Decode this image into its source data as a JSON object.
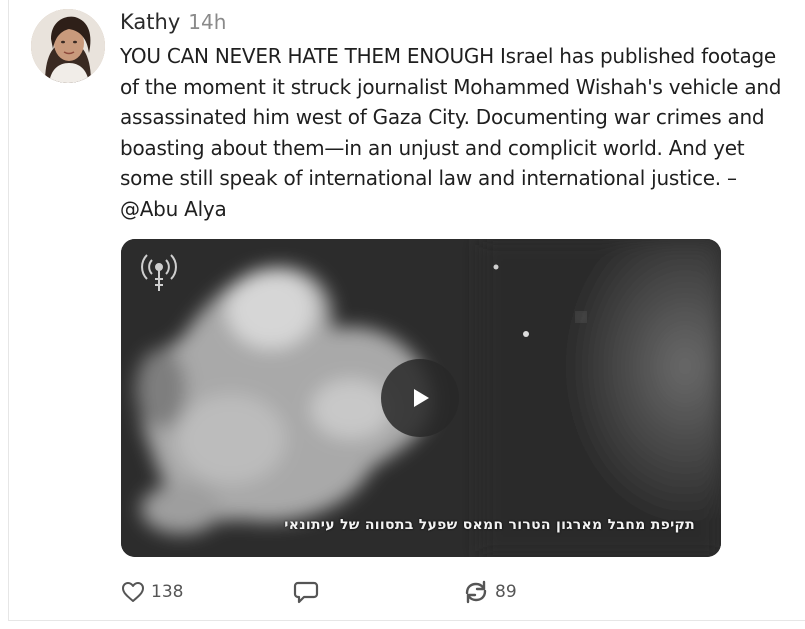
{
  "post": {
    "author": "Kathy",
    "time": "14h",
    "text": "YOU CAN NEVER HATE THEM ENOUGH Israel has published footage\nof the moment it struck journalist Mohammed Wishah's vehicle and\nassassinated him west of Gaza City. Documenting war crimes and\nboasting about them—in an unjust and complicit world. And yet\nsome still speak of international law and international justice. –\n@Abu Alya",
    "video": {
      "caption": "תקיפת מחבל מארגון הטרור חמאס שפעל בתסווה של עיתונאי"
    },
    "actions": {
      "likes": "138",
      "reposts": "89"
    }
  },
  "icons": {
    "like": "heart-icon",
    "reply": "speech-bubble-icon",
    "repost": "repost-arrows-icon",
    "play": "play-icon",
    "watermark": "antenna-signal-icon"
  },
  "colors": {
    "text": "#1f1f1f",
    "muted": "#8a8a8a",
    "icon": "#555555"
  }
}
